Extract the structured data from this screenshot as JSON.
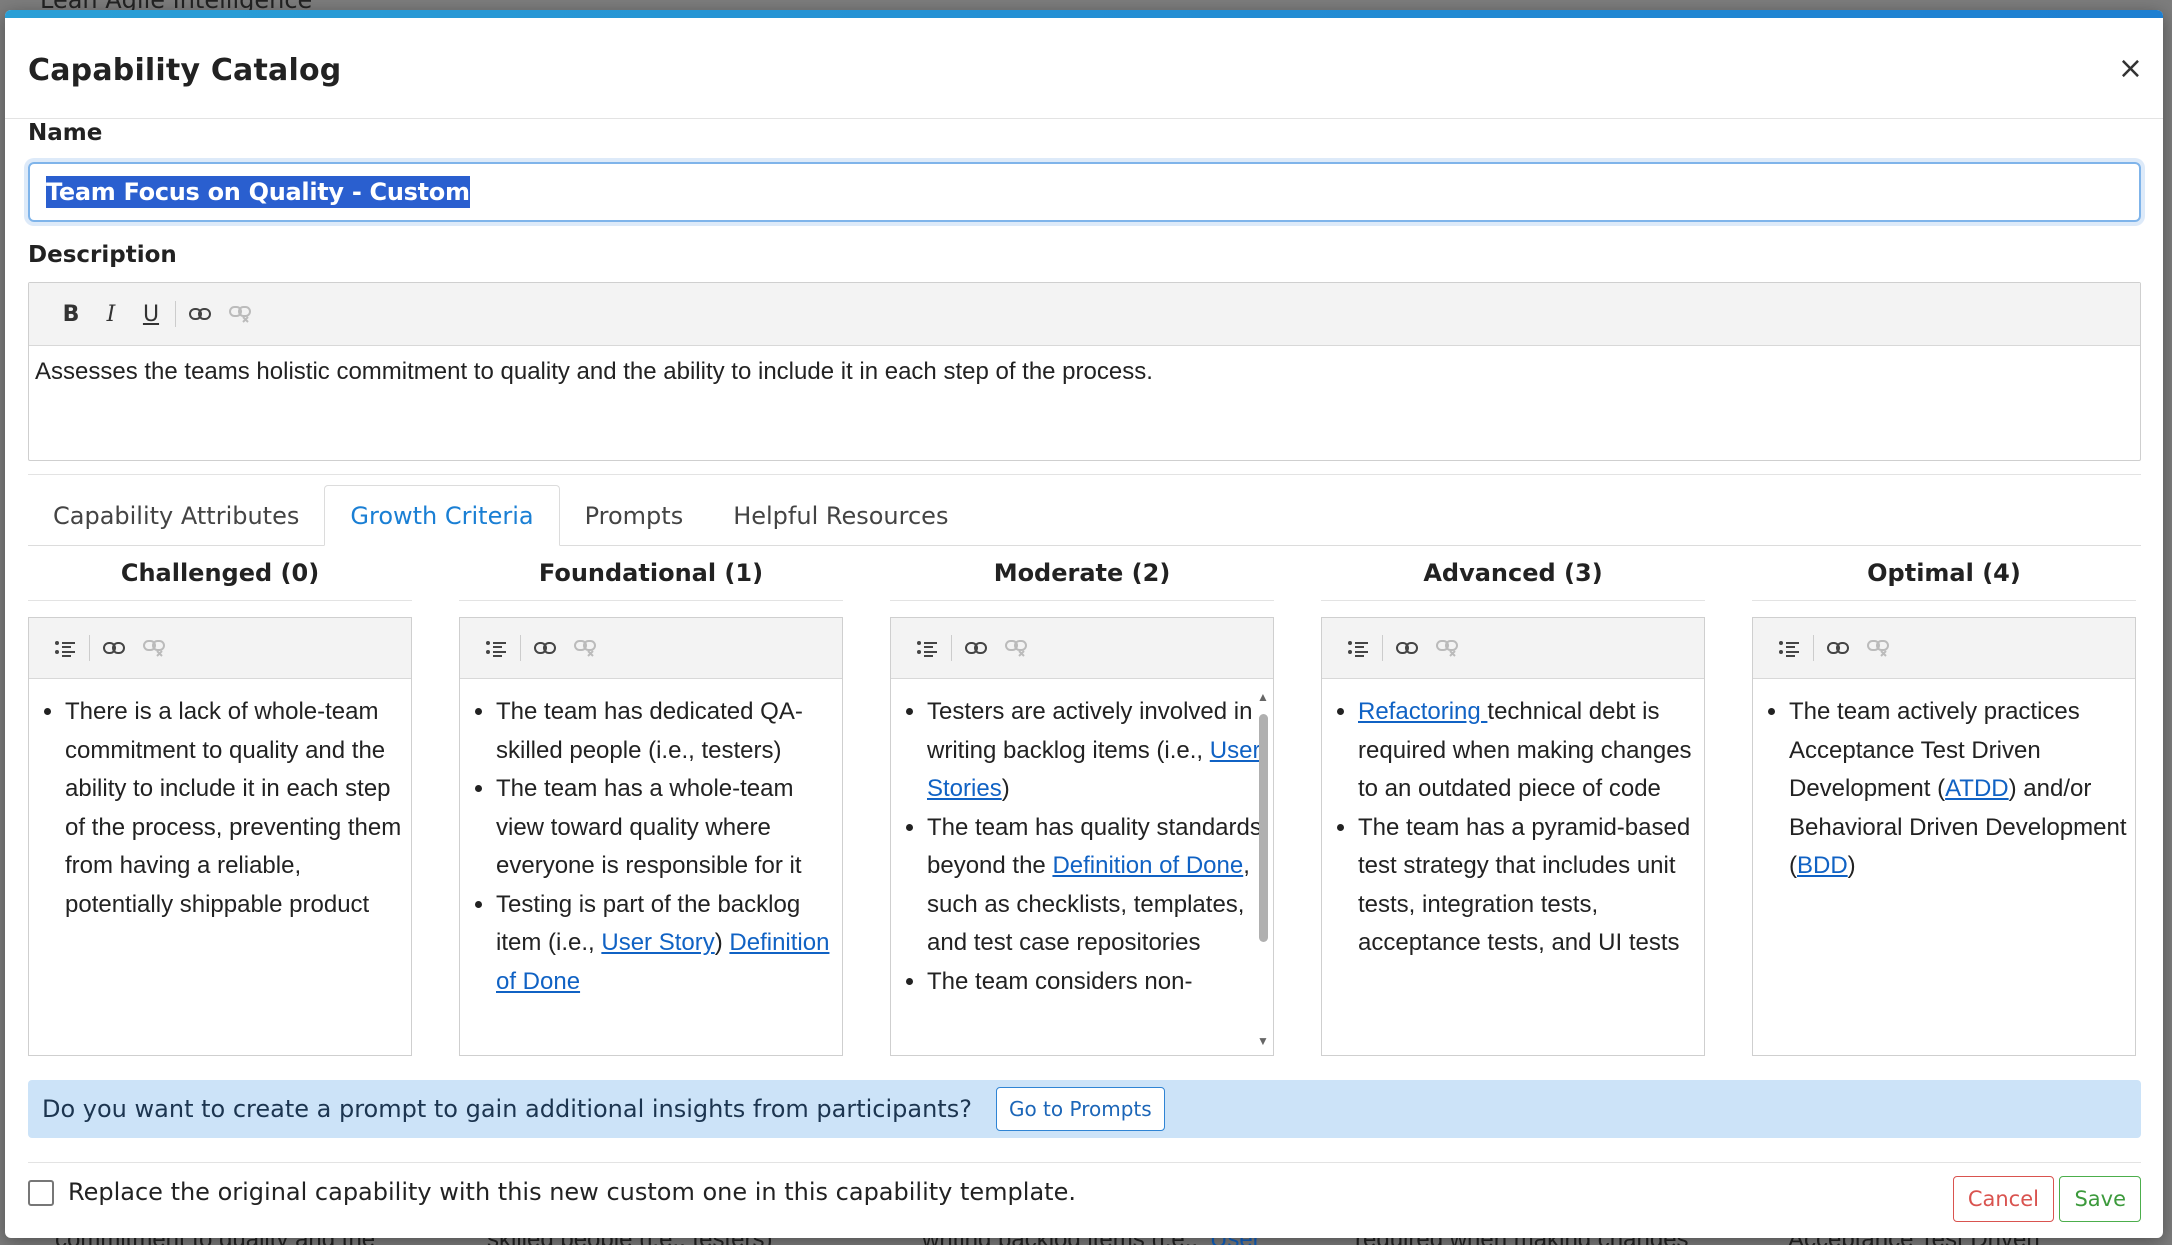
{
  "background": {
    "top_text": "Lean Agile Intelligence",
    "bottom_snippets": [
      "commitment to quality and the",
      "skilled people (i.e., testers)",
      "writing backlog items (i.e.,",
      "User",
      "required when making changes",
      "Acceptance Test Driven"
    ]
  },
  "modal": {
    "title": "Capability Catalog",
    "close_glyph": "×"
  },
  "name": {
    "label": "Name",
    "value": "Team Focus on Quality - Custom"
  },
  "description": {
    "label": "Description",
    "toolbar": [
      "bold",
      "italic",
      "underline",
      "link",
      "unlink"
    ],
    "text": "Assesses the teams holistic commitment to quality and the ability to include it in each step of the process."
  },
  "tabs": [
    {
      "label": "Capability Attributes",
      "active": false
    },
    {
      "label": "Growth Criteria",
      "active": true
    },
    {
      "label": "Prompts",
      "active": false
    },
    {
      "label": "Helpful Resources",
      "active": false
    }
  ],
  "levels": [
    {
      "title": "Challenged (0)",
      "items": [
        [
          {
            "t": "There is a lack of whole-team commitment to quality and the ability to include it in each step of the process, preventing them from having a reliable, potentially shippable product"
          }
        ]
      ]
    },
    {
      "title": "Foundational (1)",
      "items": [
        [
          {
            "t": "The team has dedicated QA-skilled people (i.e., testers)"
          }
        ],
        [
          {
            "t": "The team has a whole-team view toward quality where everyone is responsible for it"
          }
        ],
        [
          {
            "t": "Testing is part of the backlog item (i.e., "
          },
          {
            "link": "User Story"
          },
          {
            "t": ") "
          },
          {
            "link": "Definition of Done"
          }
        ]
      ]
    },
    {
      "title": "Moderate (2)",
      "items": [
        [
          {
            "t": "Testers are actively involved in writing backlog items (i.e., "
          },
          {
            "link": "User Stories"
          },
          {
            "t": ")"
          }
        ],
        [
          {
            "t": "The team has quality standards beyond the "
          },
          {
            "link": "Definition of Done"
          },
          {
            "t": ", such as checklists, templates, and test case repositories"
          }
        ],
        [
          {
            "t": "The team considers non-"
          }
        ]
      ]
    },
    {
      "title": "Advanced (3)",
      "items": [
        [
          {
            "link": "Refactoring "
          },
          {
            "t": "technical debt is required when making changes to an outdated piece of code"
          }
        ],
        [
          {
            "t": "The team has a pyramid-based test strategy that includes unit tests, integration tests, acceptance tests, and UI tests"
          }
        ]
      ]
    },
    {
      "title": "Optimal (4)",
      "items": [
        [
          {
            "t": "The team actively practices Acceptance Test Driven Development ("
          },
          {
            "link": "ATDD"
          },
          {
            "t": ") and/or Behavioral Driven Development ("
          },
          {
            "link": "BDD"
          },
          {
            "t": ")"
          }
        ]
      ]
    }
  ],
  "prompt_banner": {
    "text": "Do you want to create a prompt to gain additional insights from participants?",
    "button": "Go to Prompts"
  },
  "footer": {
    "checkbox_label": "Replace the original capability with this new custom one in this capability template.",
    "checked": false,
    "cancel": "Cancel",
    "save": "Save"
  },
  "colors": {
    "accent": "#1a7fd4",
    "link": "#1062c4",
    "banner": "#cce3f8",
    "cancel": "#d9534f",
    "save": "#3c9a3c"
  }
}
